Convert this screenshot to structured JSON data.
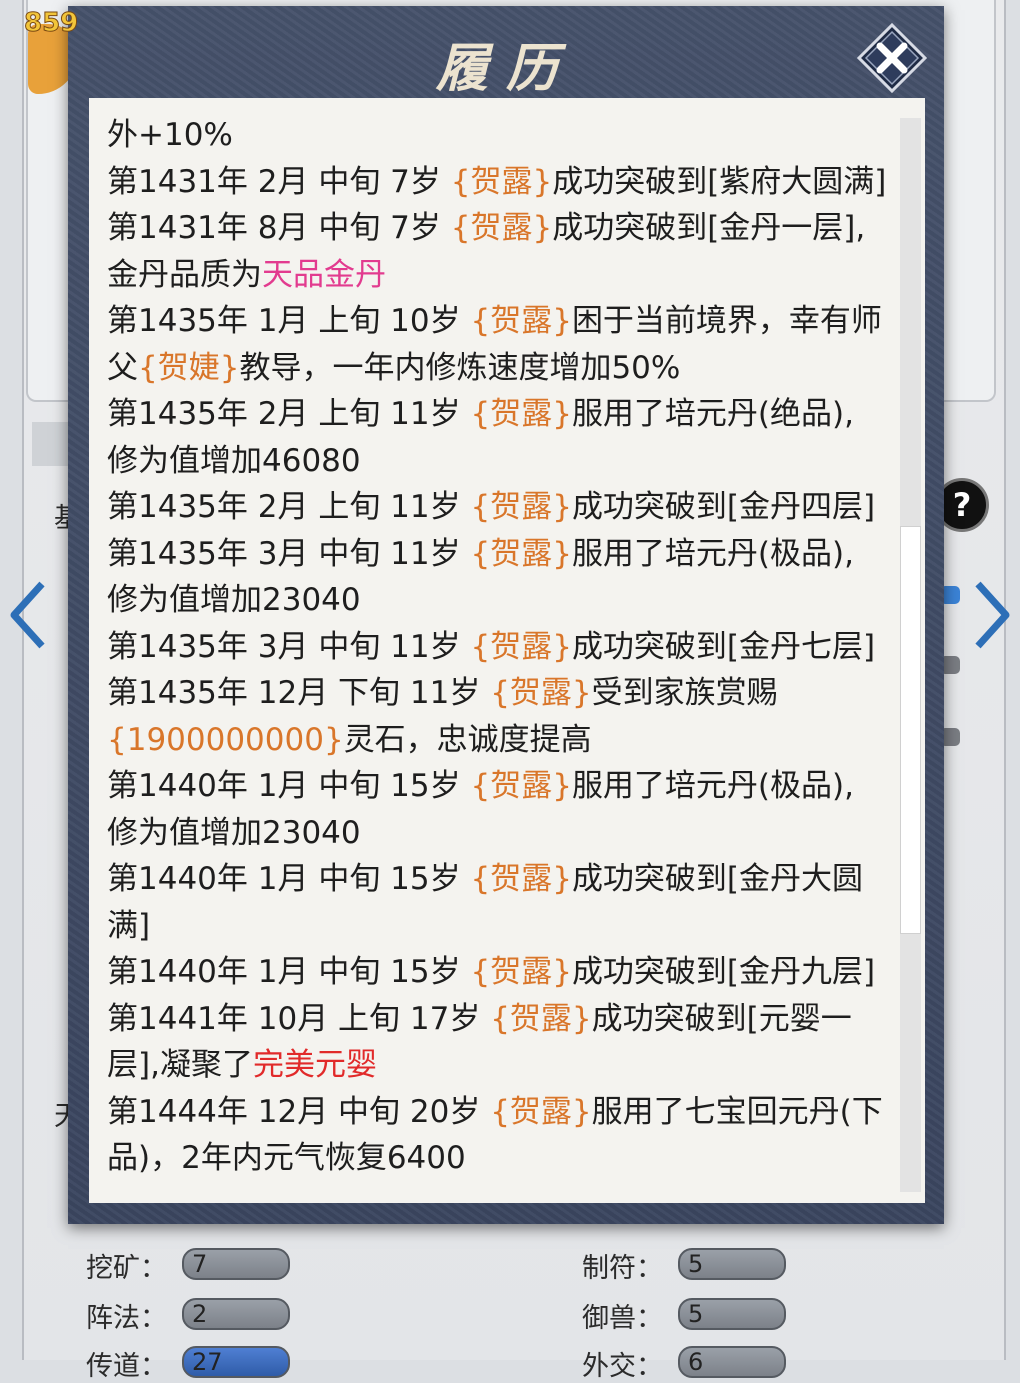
{
  "background": {
    "currency": "859",
    "tab_label_1": "基",
    "tab_label_2": "天",
    "stats": [
      {
        "label": "挖矿：",
        "value": "7"
      },
      {
        "label": "制符：",
        "value": "5"
      },
      {
        "label": "阵法：",
        "value": "2"
      },
      {
        "label": "御兽：",
        "value": "5"
      },
      {
        "label": "传道：",
        "value": "27"
      },
      {
        "label": "外交：",
        "value": "6"
      }
    ]
  },
  "modal": {
    "title": "履历",
    "close_icon": "close-x-icon",
    "entries": [
      [
        {
          "t": "外+10%"
        }
      ],
      [
        {
          "t": "第1431年 2月 中旬 7岁 "
        },
        {
          "t": "{贺露}",
          "c": "cn"
        },
        {
          "t": "成功突破到[紫府大圆满]"
        }
      ],
      [
        {
          "t": "第1431年 8月 中旬 7岁 "
        },
        {
          "t": "{贺露}",
          "c": "cn"
        },
        {
          "t": "成功突破到[金丹一层],"
        }
      ],
      [
        {
          "t": "金丹品质为"
        },
        {
          "t": "天品金丹",
          "c": "pink"
        }
      ],
      [
        {
          "t": "第1435年 1月 上旬 10岁 "
        },
        {
          "t": "{贺露}",
          "c": "cn"
        },
        {
          "t": "困于当前境界，幸有师"
        }
      ],
      [
        {
          "t": "父"
        },
        {
          "t": "{贺婕}",
          "c": "cn"
        },
        {
          "t": "教导，一年内修炼速度增加50%"
        }
      ],
      [
        {
          "t": "第1435年 2月 上旬 11岁 "
        },
        {
          "t": "{贺露}",
          "c": "cn"
        },
        {
          "t": "服用了培元丹(绝品),"
        }
      ],
      [
        {
          "t": "修为值增加46080"
        }
      ],
      [
        {
          "t": "第1435年 2月 上旬 11岁 "
        },
        {
          "t": "{贺露}",
          "c": "cn"
        },
        {
          "t": "成功突破到[金丹四层]"
        }
      ],
      [
        {
          "t": "第1435年 3月 中旬 11岁 "
        },
        {
          "t": "{贺露}",
          "c": "cn"
        },
        {
          "t": "服用了培元丹(极品),"
        }
      ],
      [
        {
          "t": "修为值增加23040"
        }
      ],
      [
        {
          "t": "第1435年 3月 中旬 11岁 "
        },
        {
          "t": "{贺露}",
          "c": "cn"
        },
        {
          "t": "成功突破到[金丹七层]"
        }
      ],
      [
        {
          "t": "第1435年  12月  下旬   11岁   "
        },
        {
          "t": "{贺露}",
          "c": "cn"
        },
        {
          "t": "受到家族赏赐"
        }
      ],
      [
        {
          "t": "{1900000000}",
          "c": "cn"
        },
        {
          "t": "灵石，忠诚度提高"
        }
      ],
      [
        {
          "t": "第1440年 1月 中旬 15岁 "
        },
        {
          "t": "{贺露}",
          "c": "cn"
        },
        {
          "t": "服用了培元丹(极品),"
        }
      ],
      [
        {
          "t": "修为值增加23040"
        }
      ],
      [
        {
          "t": "第1440年 1月 中旬  15岁 "
        },
        {
          "t": "{贺露}",
          "c": "cn"
        },
        {
          "t": "成功突破到[金丹大圆"
        }
      ],
      [
        {
          "t": "满]"
        }
      ],
      [
        {
          "t": "第1440年 1月 中旬 15岁 "
        },
        {
          "t": "{贺露}",
          "c": "cn"
        },
        {
          "t": "成功突破到[金丹九层]"
        }
      ],
      [
        {
          "t": "第1441年 10月 上旬 17岁 "
        },
        {
          "t": "{贺露}",
          "c": "cn"
        },
        {
          "t": "成功突破到[元婴一"
        }
      ],
      [
        {
          "t": "层],凝聚了"
        },
        {
          "t": "完美元婴",
          "c": "red"
        }
      ],
      [
        {
          "t": "第1444年 12月 中旬 20岁 "
        },
        {
          "t": "{贺露}",
          "c": "cn"
        },
        {
          "t": "服用了七宝回元丹(下"
        }
      ],
      [
        {
          "t": "品)，2年内元气恢复6400"
        }
      ]
    ]
  }
}
